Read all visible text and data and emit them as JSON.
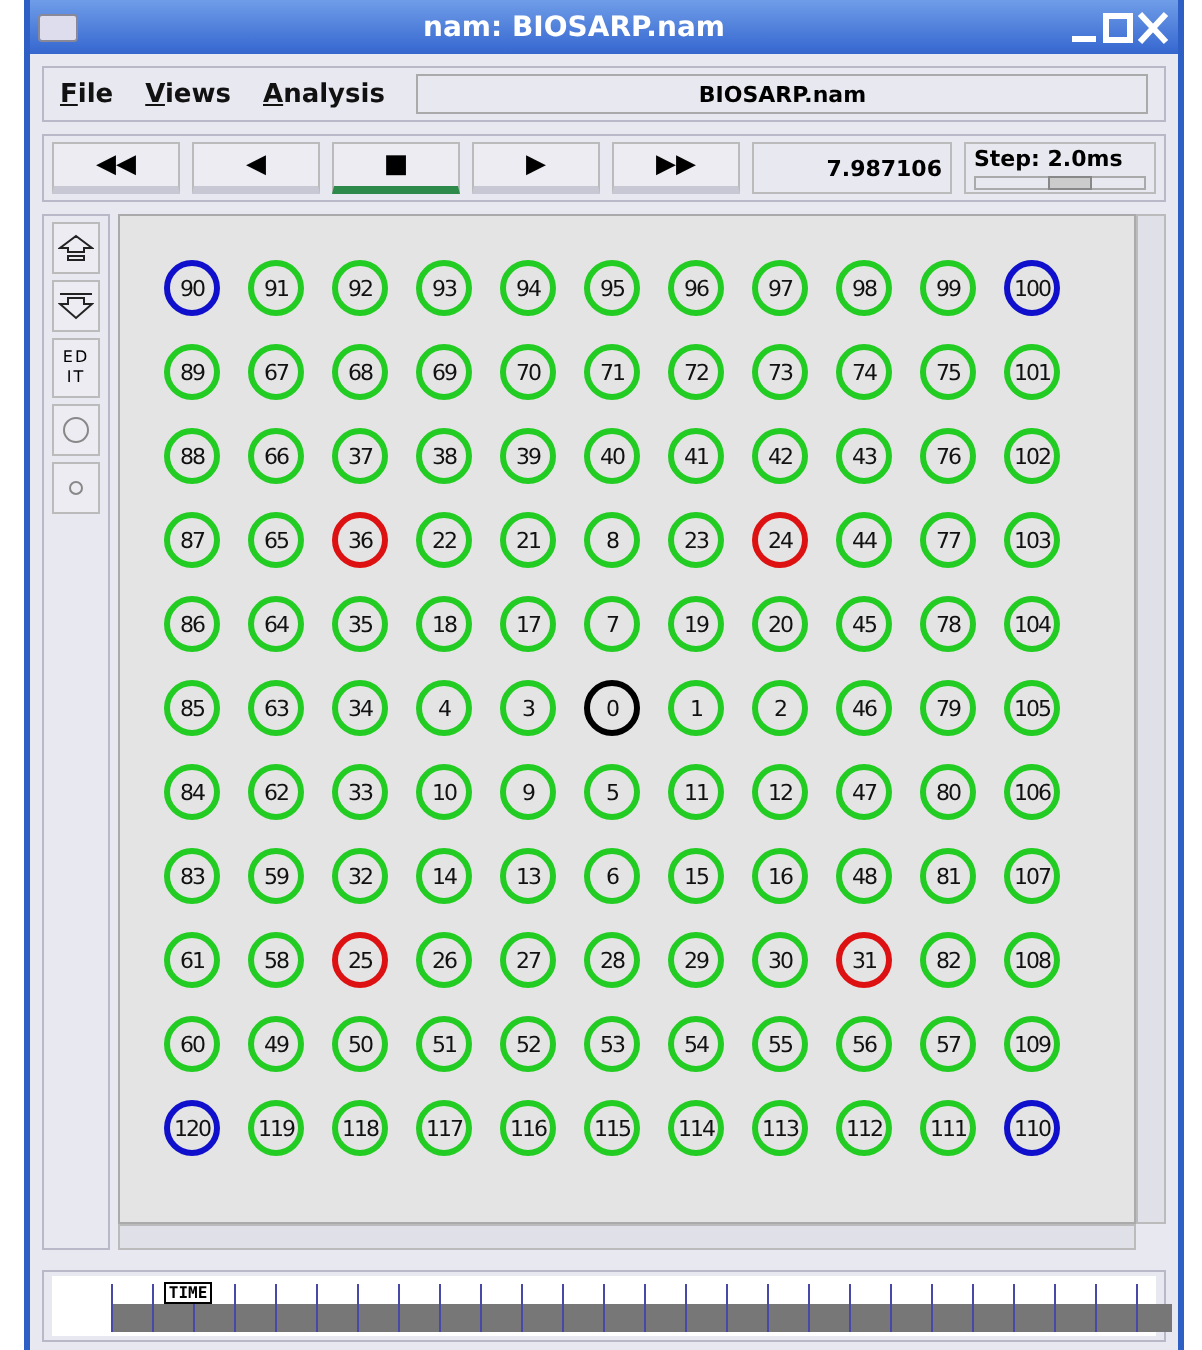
{
  "window": {
    "title": "nam: BIOSARP.nam"
  },
  "menu": [
    "File",
    "Views",
    "Analysis"
  ],
  "file_field": {
    "value": "BIOSARP.nam"
  },
  "transport": [
    {
      "label": "◀◀",
      "selected": false
    },
    {
      "label": "◀",
      "selected": false
    },
    {
      "label": "■",
      "selected": true
    },
    {
      "label": "▶",
      "selected": false
    },
    {
      "label": "▶▶",
      "selected": false
    }
  ],
  "time": "7.987106",
  "step": {
    "label": "Step: 2.0ms",
    "level": 0.55
  },
  "tools": [
    {
      "kind": "zoom-in"
    },
    {
      "kind": "zoom-out"
    },
    {
      "kind": "edit",
      "label": "ED IT"
    },
    {
      "kind": "big-circle"
    },
    {
      "kind": "small-circle"
    }
  ],
  "nodes": [
    [
      {
        "label": "90",
        "color": "#1010cc"
      },
      {
        "label": "91",
        "color": "#22cc22"
      },
      {
        "label": "92",
        "color": "#22cc22"
      },
      {
        "label": "93",
        "color": "#22cc22"
      },
      {
        "label": "94",
        "color": "#22cc22"
      },
      {
        "label": "95",
        "color": "#22cc22"
      },
      {
        "label": "96",
        "color": "#22cc22"
      },
      {
        "label": "97",
        "color": "#22cc22"
      },
      {
        "label": "98",
        "color": "#22cc22"
      },
      {
        "label": "99",
        "color": "#22cc22"
      },
      {
        "label": "100",
        "color": "#1010cc"
      }
    ],
    [
      {
        "label": "89",
        "color": "#22cc22"
      },
      {
        "label": "67",
        "color": "#22cc22"
      },
      {
        "label": "68",
        "color": "#22cc22"
      },
      {
        "label": "69",
        "color": "#22cc22"
      },
      {
        "label": "70",
        "color": "#22cc22"
      },
      {
        "label": "71",
        "color": "#22cc22"
      },
      {
        "label": "72",
        "color": "#22cc22"
      },
      {
        "label": "73",
        "color": "#22cc22"
      },
      {
        "label": "74",
        "color": "#22cc22"
      },
      {
        "label": "75",
        "color": "#22cc22"
      },
      {
        "label": "101",
        "color": "#22cc22"
      }
    ],
    [
      {
        "label": "88",
        "color": "#22cc22"
      },
      {
        "label": "66",
        "color": "#22cc22"
      },
      {
        "label": "37",
        "color": "#22cc22"
      },
      {
        "label": "38",
        "color": "#22cc22"
      },
      {
        "label": "39",
        "color": "#22cc22"
      },
      {
        "label": "40",
        "color": "#22cc22"
      },
      {
        "label": "41",
        "color": "#22cc22"
      },
      {
        "label": "42",
        "color": "#22cc22"
      },
      {
        "label": "43",
        "color": "#22cc22"
      },
      {
        "label": "76",
        "color": "#22cc22"
      },
      {
        "label": "102",
        "color": "#22cc22"
      }
    ],
    [
      {
        "label": "87",
        "color": "#22cc22"
      },
      {
        "label": "65",
        "color": "#22cc22"
      },
      {
        "label": "36",
        "color": "#dd1111"
      },
      {
        "label": "22",
        "color": "#22cc22"
      },
      {
        "label": "21",
        "color": "#22cc22"
      },
      {
        "label": "8",
        "color": "#22cc22"
      },
      {
        "label": "23",
        "color": "#22cc22"
      },
      {
        "label": "24",
        "color": "#dd1111"
      },
      {
        "label": "44",
        "color": "#22cc22"
      },
      {
        "label": "77",
        "color": "#22cc22"
      },
      {
        "label": "103",
        "color": "#22cc22"
      }
    ],
    [
      {
        "label": "86",
        "color": "#22cc22"
      },
      {
        "label": "64",
        "color": "#22cc22"
      },
      {
        "label": "35",
        "color": "#22cc22"
      },
      {
        "label": "18",
        "color": "#22cc22"
      },
      {
        "label": "17",
        "color": "#22cc22"
      },
      {
        "label": "7",
        "color": "#22cc22"
      },
      {
        "label": "19",
        "color": "#22cc22"
      },
      {
        "label": "20",
        "color": "#22cc22"
      },
      {
        "label": "45",
        "color": "#22cc22"
      },
      {
        "label": "78",
        "color": "#22cc22"
      },
      {
        "label": "104",
        "color": "#22cc22"
      }
    ],
    [
      {
        "label": "85",
        "color": "#22cc22"
      },
      {
        "label": "63",
        "color": "#22cc22"
      },
      {
        "label": "34",
        "color": "#22cc22"
      },
      {
        "label": "4",
        "color": "#22cc22"
      },
      {
        "label": "3",
        "color": "#22cc22"
      },
      {
        "label": "0",
        "color": "#000000"
      },
      {
        "label": "1",
        "color": "#22cc22"
      },
      {
        "label": "2",
        "color": "#22cc22"
      },
      {
        "label": "46",
        "color": "#22cc22"
      },
      {
        "label": "79",
        "color": "#22cc22"
      },
      {
        "label": "105",
        "color": "#22cc22"
      }
    ],
    [
      {
        "label": "84",
        "color": "#22cc22"
      },
      {
        "label": "62",
        "color": "#22cc22"
      },
      {
        "label": "33",
        "color": "#22cc22"
      },
      {
        "label": "10",
        "color": "#22cc22"
      },
      {
        "label": "9",
        "color": "#22cc22"
      },
      {
        "label": "5",
        "color": "#22cc22"
      },
      {
        "label": "11",
        "color": "#22cc22"
      },
      {
        "label": "12",
        "color": "#22cc22"
      },
      {
        "label": "47",
        "color": "#22cc22"
      },
      {
        "label": "80",
        "color": "#22cc22"
      },
      {
        "label": "106",
        "color": "#22cc22"
      }
    ],
    [
      {
        "label": "83",
        "color": "#22cc22"
      },
      {
        "label": "59",
        "color": "#22cc22"
      },
      {
        "label": "32",
        "color": "#22cc22"
      },
      {
        "label": "14",
        "color": "#22cc22"
      },
      {
        "label": "13",
        "color": "#22cc22"
      },
      {
        "label": "6",
        "color": "#22cc22"
      },
      {
        "label": "15",
        "color": "#22cc22"
      },
      {
        "label": "16",
        "color": "#22cc22"
      },
      {
        "label": "48",
        "color": "#22cc22"
      },
      {
        "label": "81",
        "color": "#22cc22"
      },
      {
        "label": "107",
        "color": "#22cc22"
      }
    ],
    [
      {
        "label": "61",
        "color": "#22cc22"
      },
      {
        "label": "58",
        "color": "#22cc22"
      },
      {
        "label": "25",
        "color": "#dd1111"
      },
      {
        "label": "26",
        "color": "#22cc22"
      },
      {
        "label": "27",
        "color": "#22cc22"
      },
      {
        "label": "28",
        "color": "#22cc22"
      },
      {
        "label": "29",
        "color": "#22cc22"
      },
      {
        "label": "30",
        "color": "#22cc22"
      },
      {
        "label": "31",
        "color": "#dd1111"
      },
      {
        "label": "82",
        "color": "#22cc22"
      },
      {
        "label": "108",
        "color": "#22cc22"
      }
    ],
    [
      {
        "label": "60",
        "color": "#22cc22"
      },
      {
        "label": "49",
        "color": "#22cc22"
      },
      {
        "label": "50",
        "color": "#22cc22"
      },
      {
        "label": "51",
        "color": "#22cc22"
      },
      {
        "label": "52",
        "color": "#22cc22"
      },
      {
        "label": "53",
        "color": "#22cc22"
      },
      {
        "label": "54",
        "color": "#22cc22"
      },
      {
        "label": "55",
        "color": "#22cc22"
      },
      {
        "label": "56",
        "color": "#22cc22"
      },
      {
        "label": "57",
        "color": "#22cc22"
      },
      {
        "label": "109",
        "color": "#22cc22"
      }
    ],
    [
      {
        "label": "120",
        "color": "#1010cc"
      },
      {
        "label": "119",
        "color": "#22cc22"
      },
      {
        "label": "118",
        "color": "#22cc22"
      },
      {
        "label": "117",
        "color": "#22cc22"
      },
      {
        "label": "116",
        "color": "#22cc22"
      },
      {
        "label": "115",
        "color": "#22cc22"
      },
      {
        "label": "114",
        "color": "#22cc22"
      },
      {
        "label": "113",
        "color": "#22cc22"
      },
      {
        "label": "112",
        "color": "#22cc22"
      },
      {
        "label": "111",
        "color": "#22cc22"
      },
      {
        "label": "110",
        "color": "#1010cc"
      }
    ]
  ],
  "timeline": {
    "marker": "TIME",
    "level": 0.08
  }
}
